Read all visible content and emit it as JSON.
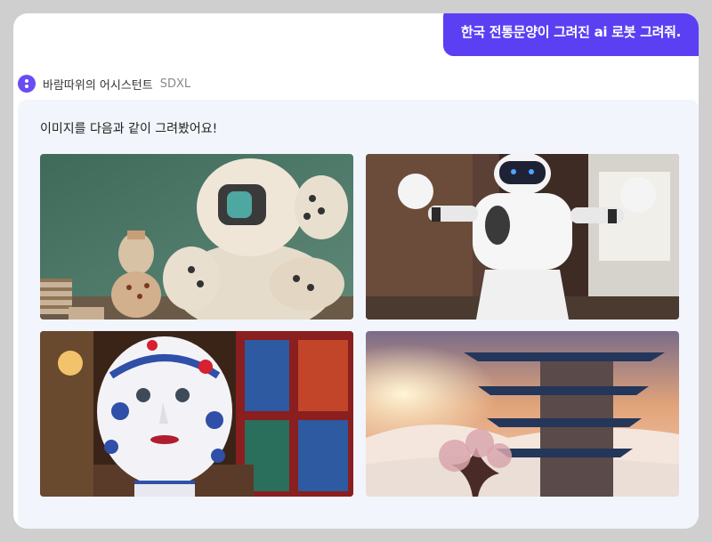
{
  "user_message": "한국 전통문양이 그려진 ai 로봇 그려줘.",
  "assistant": {
    "name": "바람따위의 어시스턴트",
    "model": "SDXL",
    "avatar_icon": "assistant-avatar-icon"
  },
  "response": {
    "text": "이미지를 다음과 같이 그려봤어요!"
  },
  "images": [
    {
      "icon": "robot-with-pottery-image"
    },
    {
      "icon": "white-robot-in-room-image"
    },
    {
      "icon": "patterned-robot-head-image"
    },
    {
      "icon": "korean-pagoda-sunset-image"
    }
  ],
  "colors": {
    "accent": "#5b3ff2",
    "panel": "#f2f5fb",
    "page": "#cfcfcf"
  }
}
